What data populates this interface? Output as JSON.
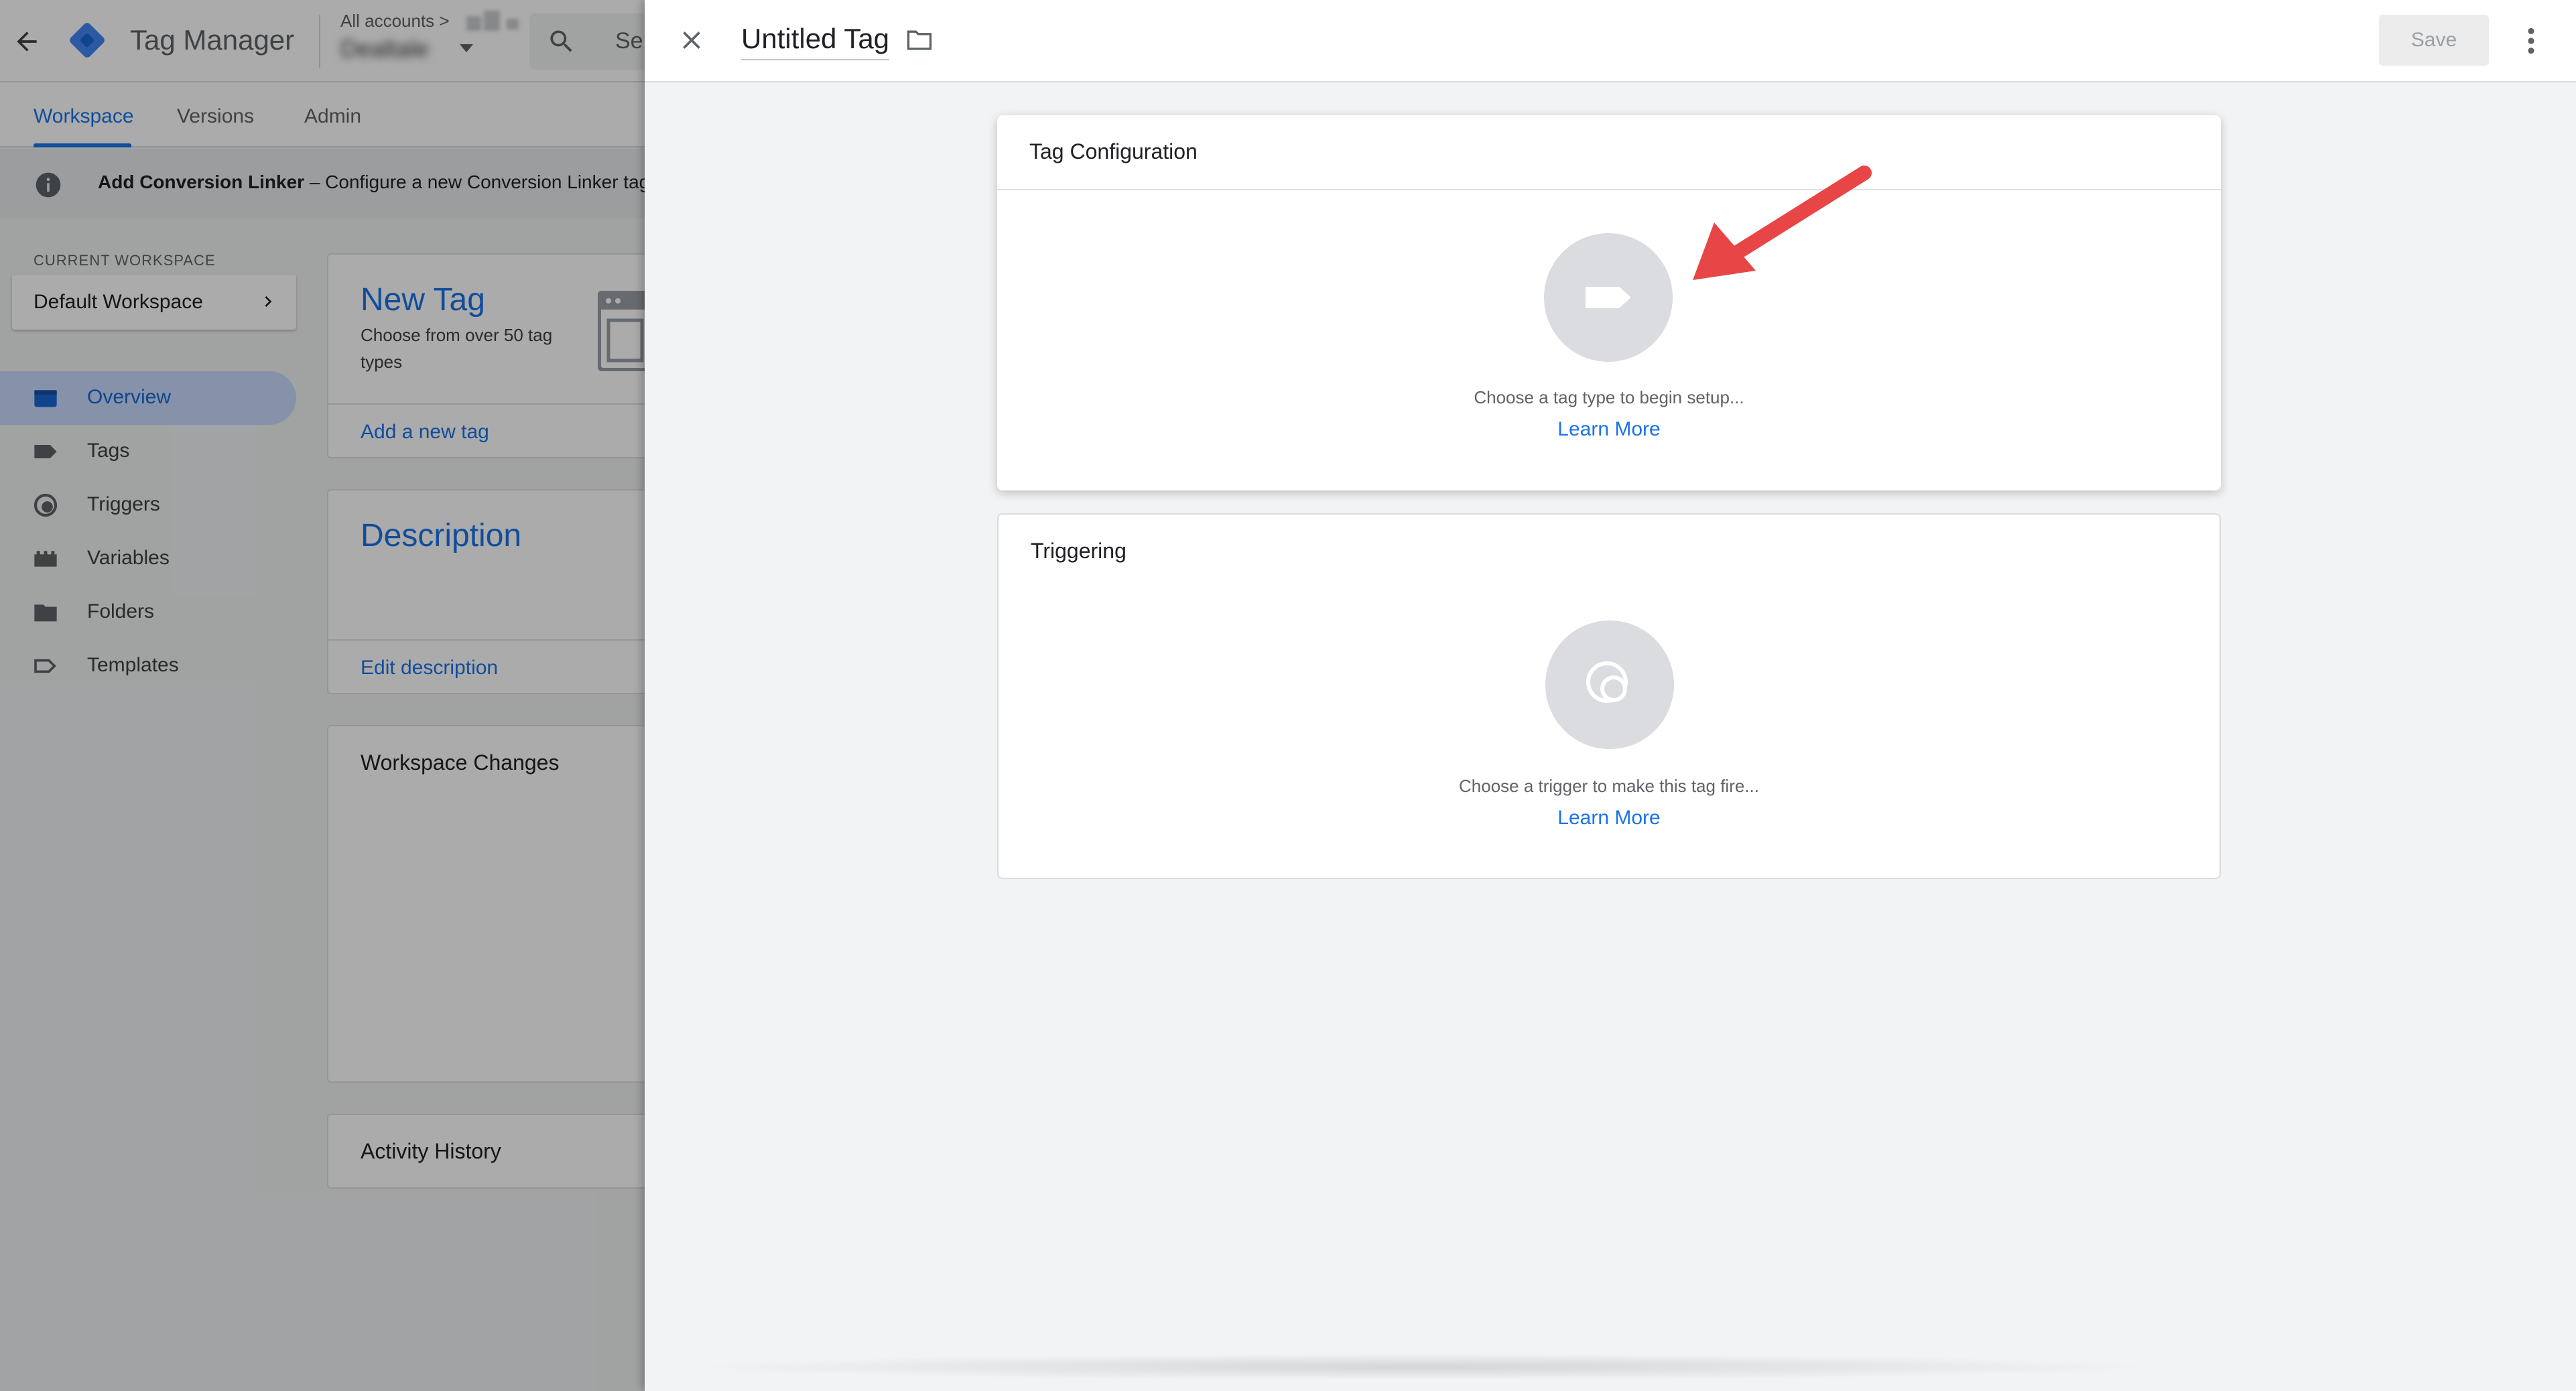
{
  "app": {
    "product_name": "Tag Manager",
    "account_breadcrumb": "All accounts >",
    "container_name": "Dealtale",
    "search_placeholder": "Se"
  },
  "nav_tabs": [
    {
      "label": "Workspace",
      "active": true
    },
    {
      "label": "Versions",
      "active": false
    },
    {
      "label": "Admin",
      "active": false
    }
  ],
  "banner": {
    "title": "Add Conversion Linker",
    "text": " – Configure a new Conversion Linker tag to i"
  },
  "workspace": {
    "section_label": "CURRENT WORKSPACE",
    "selected": "Default Workspace"
  },
  "sidebar": {
    "items": [
      {
        "label": "Overview",
        "icon": "overview-icon",
        "active": true
      },
      {
        "label": "Tags",
        "icon": "tag-icon",
        "active": false
      },
      {
        "label": "Triggers",
        "icon": "trigger-icon",
        "active": false
      },
      {
        "label": "Variables",
        "icon": "variables-icon",
        "active": false
      },
      {
        "label": "Folders",
        "icon": "folder-icon",
        "active": false
      },
      {
        "label": "Templates",
        "icon": "template-icon",
        "active": false
      }
    ]
  },
  "cards": {
    "new_tag": {
      "title": "New Tag",
      "subtitle": "Choose from over 50 tag types",
      "link": "Add a new tag"
    },
    "description": {
      "title": "Description",
      "link": "Edit description"
    },
    "workspace_changes": {
      "title": "Workspace Changes"
    },
    "activity_history": {
      "title": "Activity History"
    }
  },
  "editor": {
    "tag_name": "Untitled Tag",
    "save_label": "Save",
    "tag_configuration": {
      "title": "Tag Configuration",
      "hint": "Choose a tag type to begin setup...",
      "learn_more": "Learn More"
    },
    "triggering": {
      "title": "Triggering",
      "hint": "Choose a trigger to make this tag fire...",
      "learn_more": "Learn More"
    }
  },
  "colors": {
    "accent_blue": "#1a73e8",
    "active_nav_bg": "#c6dafc",
    "annotation_arrow": "#e84646",
    "gtm_logo_blue": "#4285f4",
    "gtm_logo_dark": "#1967d2"
  }
}
